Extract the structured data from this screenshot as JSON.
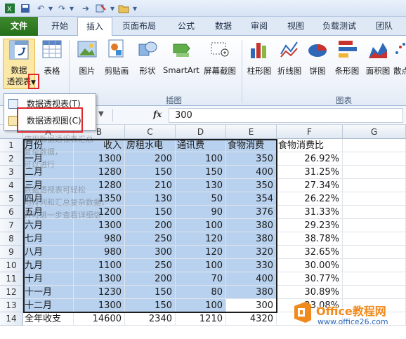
{
  "ribbon_tabs": [
    "文件",
    "开始",
    "插入",
    "页面布局",
    "公式",
    "数据",
    "审阅",
    "视图",
    "负载测试",
    "团队"
  ],
  "ribbon": {
    "pivot_line1": "数据",
    "pivot_line2": "透视表",
    "table": "表格",
    "picture": "图片",
    "clipart": "剪贴画",
    "shapes": "形状",
    "smartart": "SmartArt",
    "screenshot": "屏幕截图",
    "column_chart": "柱形图",
    "line_chart": "折线图",
    "pie_chart": "饼图",
    "bar_chart": "条形图",
    "area_chart": "面积图",
    "scatter_chart": "散点",
    "group_illustrations": "插图",
    "group_charts": "图表"
  },
  "menu": {
    "item1": "数据透视表(T)",
    "item2": "数据透视图(C)"
  },
  "formula_bar": {
    "fx": "fx",
    "value": "300"
  },
  "columns": [
    "A",
    "B",
    "C",
    "D",
    "E",
    "F",
    "G"
  ],
  "rows": [
    "1",
    "2",
    "3",
    "4",
    "5",
    "6",
    "7",
    "8",
    "9",
    "10",
    "11",
    "12",
    "13",
    "14"
  ],
  "table": [
    [
      "月份",
      "收入",
      "房租水电",
      "通讯费",
      "食物消费",
      "食物消费比"
    ],
    [
      "一月",
      "1300",
      "200",
      "100",
      "350",
      "26.92%"
    ],
    [
      "二月",
      "1280",
      "150",
      "150",
      "400",
      "31.25%"
    ],
    [
      "三月",
      "1280",
      "210",
      "130",
      "350",
      "27.34%"
    ],
    [
      "四月",
      "1350",
      "130",
      "50",
      "354",
      "26.22%"
    ],
    [
      "五月",
      "1200",
      "150",
      "90",
      "376",
      "31.33%"
    ],
    [
      "六月",
      "1300",
      "200",
      "100",
      "380",
      "29.23%"
    ],
    [
      "七月",
      "980",
      "250",
      "120",
      "380",
      "38.78%"
    ],
    [
      "八月",
      "980",
      "300",
      "120",
      "320",
      "32.65%"
    ],
    [
      "九月",
      "1100",
      "250",
      "100",
      "330",
      "30.00%"
    ],
    [
      "十月",
      "1300",
      "200",
      "70",
      "400",
      "30.77%"
    ],
    [
      "十一月",
      "1230",
      "150",
      "80",
      "380",
      "30.89%"
    ],
    [
      "十二月",
      "1300",
      "150",
      "100",
      "300",
      "23.08%"
    ],
    [
      "全年收支",
      "14600",
      "2340",
      "1210",
      "4320",
      ""
    ]
  ],
  "ghost_text": [
    "使用数据透视表汇总",
    "复杂数据，",
    "可以进行",
    "数据透视表可轻松",
    "地排列和汇总复杂数据，",
    "并可进一步查看详细信"
  ],
  "watermark": {
    "brand": "Office教程网",
    "url": "www.office26.com"
  },
  "colors": {
    "file_tab": "#2d7a21",
    "selection": "#b8d1ee",
    "highlight": "#e0262b",
    "watermark_orange": "#f08a1c"
  }
}
